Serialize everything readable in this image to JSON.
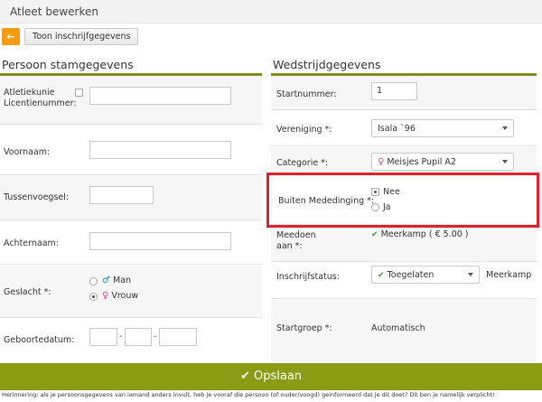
{
  "header": {
    "title": "Atleet bewerken"
  },
  "toolbar": {
    "back_icon": "←",
    "show_registration_label": "Toon inschrijfgegevens"
  },
  "left_section": {
    "title": "Persoon stamgegevens",
    "athletics_union_label": "Atletiekunie Licentienummer:",
    "first_name_label": "Voornaam:",
    "middle_name_label": "Tussenvoegsel:",
    "last_name_label": "Achternaam:",
    "gender_label": "Geslacht *:",
    "gender_options": [
      "Man",
      "Vrouw"
    ],
    "gender_selected": "Vrouw",
    "birthdate_label": "Geboortedatum:",
    "date_separator": "-"
  },
  "right_section": {
    "title": "Wedstrijdgegevens",
    "start_number_label": "Startnummer:",
    "start_number_value": "1",
    "club_label": "Vereniging *:",
    "club_value": "Isala `96",
    "category_label": "Categorie *:",
    "category_value": "Meisjes Pupil A2",
    "out_of_competition_label": "Buiten Mededinging *:",
    "out_of_competition_options": [
      "Nee",
      "Ja"
    ],
    "out_of_competition_selected": "Nee",
    "participates_label": "Meedoen aan *:",
    "participates_value": "Meerkamp",
    "participates_price": "( € 5.00 )",
    "registration_status_label": "Inschrijfstatus:",
    "registration_status_value": "Toegelaten",
    "registration_status_suffix": "Meerkamp",
    "start_group_label": "Startgroep *:",
    "start_group_value": "Automatisch"
  },
  "footer": {
    "save_label": "Opslaan",
    "save_icon": "✔",
    "reminder": "Herinnering: als je persoonsgegevens van iemand anders invult, heb je vooraf die persoon (of ouder/voogd) geinformeerd dat je dit doet? Dit ben je namelijk verplicht!"
  },
  "colors": {
    "accent": "#8b9b14",
    "back_button": "#f39c12",
    "highlight_border": "#e0202d"
  }
}
